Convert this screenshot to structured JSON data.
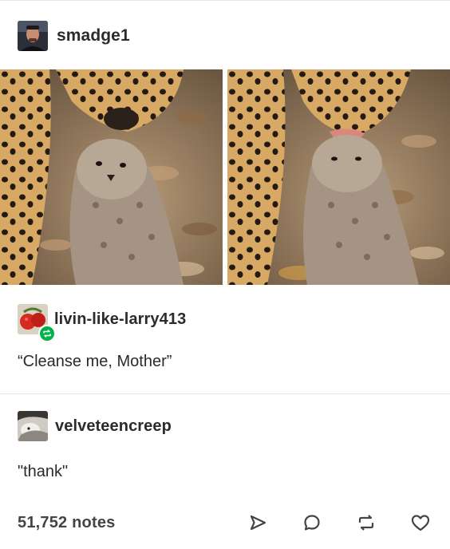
{
  "post": {
    "author": "smadge1",
    "photos": [
      "cheetah-mother-sniffing-cub",
      "cheetah-mother-licking-cub"
    ]
  },
  "reblog": {
    "author": "livin-like-larry413",
    "text": "“Cleanse me, Mother”",
    "badge_icon": "reblog-icon",
    "badge_color": "#00b24a"
  },
  "reply": {
    "author": "velveteencreep",
    "text": "\"thank\""
  },
  "footer": {
    "notes": "51,752 notes",
    "actions": [
      "share-icon",
      "reply-icon",
      "reblog-icon",
      "like-icon"
    ]
  }
}
